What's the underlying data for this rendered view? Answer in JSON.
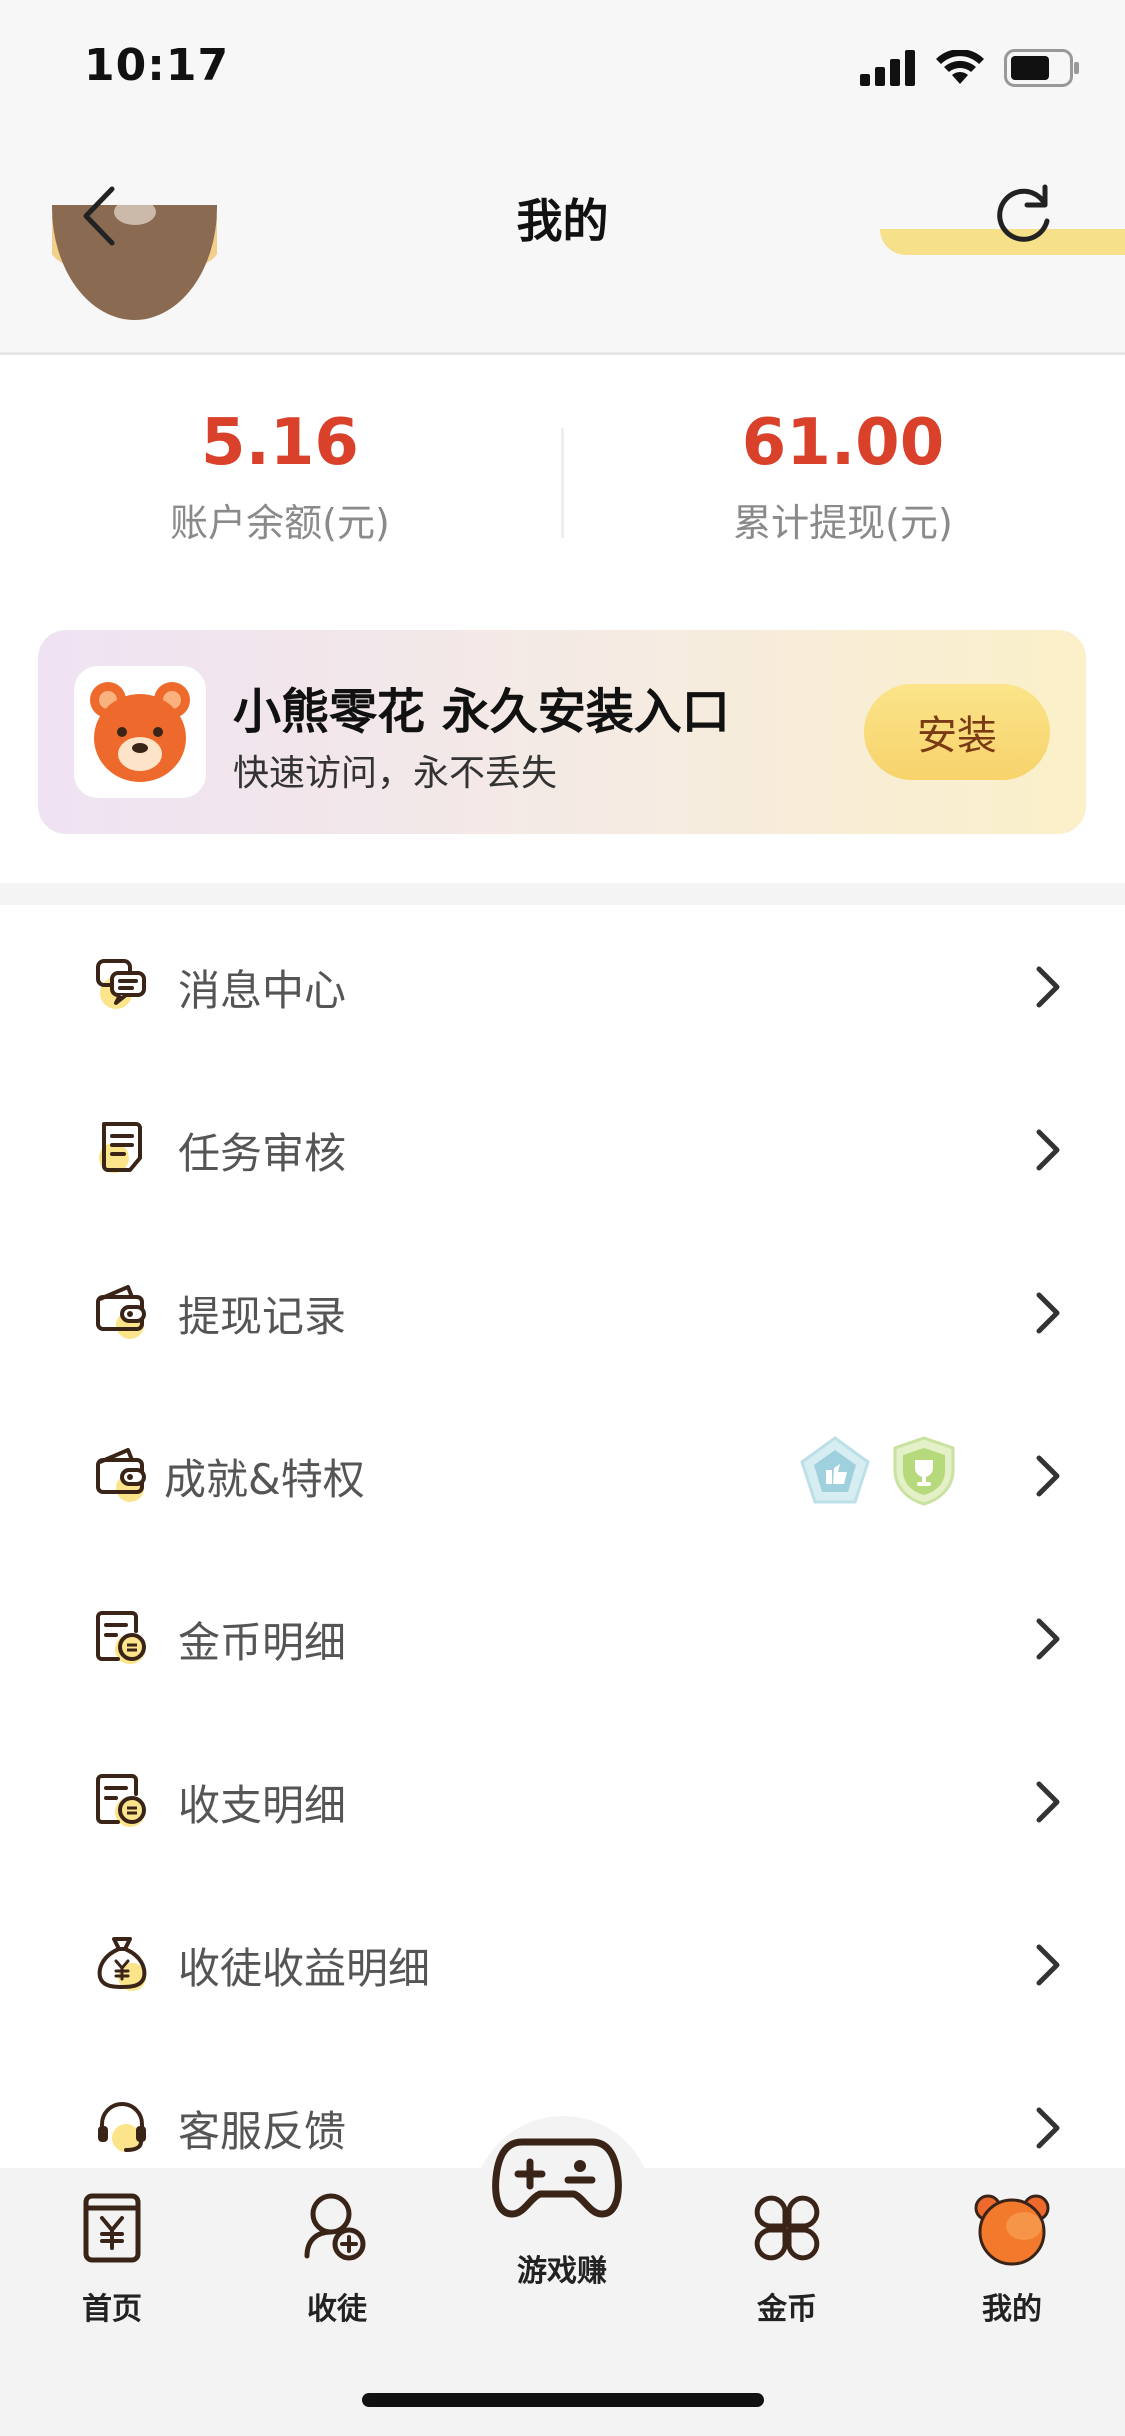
{
  "status_bar": {
    "time": "10:17"
  },
  "header": {
    "title": "我的"
  },
  "stats": [
    {
      "value": "5.16",
      "label": "账户余额(元)"
    },
    {
      "value": "61.00",
      "label": "累计提现(元)"
    }
  ],
  "banner": {
    "title": "小熊零花 永久安装入口",
    "subtitle": "快速访问，永不丢失",
    "button": "安装"
  },
  "menu": [
    {
      "label": "消息中心",
      "icon": "message-icon"
    },
    {
      "label": "任务审核",
      "icon": "task-review-icon"
    },
    {
      "label": "提现记录",
      "icon": "wallet-icon"
    },
    {
      "label": "成就&特权",
      "icon": "wallet-icon",
      "badges": [
        "like-badge-icon",
        "trophy-badge-icon"
      ]
    },
    {
      "label": "金币明细",
      "icon": "coin-detail-icon"
    },
    {
      "label": "收支明细",
      "icon": "ledger-icon"
    },
    {
      "label": "收徒收益明细",
      "icon": "money-bag-icon"
    },
    {
      "label": "客服反馈",
      "icon": "headset-icon"
    }
  ],
  "tabbar": [
    {
      "label": "首页",
      "icon": "home-yen-icon"
    },
    {
      "label": "收徒",
      "icon": "add-user-icon"
    },
    {
      "label": "游戏赚",
      "icon": "gamepad-icon"
    },
    {
      "label": "金币",
      "icon": "coins-grid-icon"
    },
    {
      "label": "我的",
      "icon": "bear-avatar-icon",
      "active": true
    }
  ],
  "colors": {
    "accent_red": "#d9412b",
    "brand_yellow": "#f7d36b",
    "icon_yellow": "#fbe48a",
    "icon_dark": "#3a2418"
  }
}
